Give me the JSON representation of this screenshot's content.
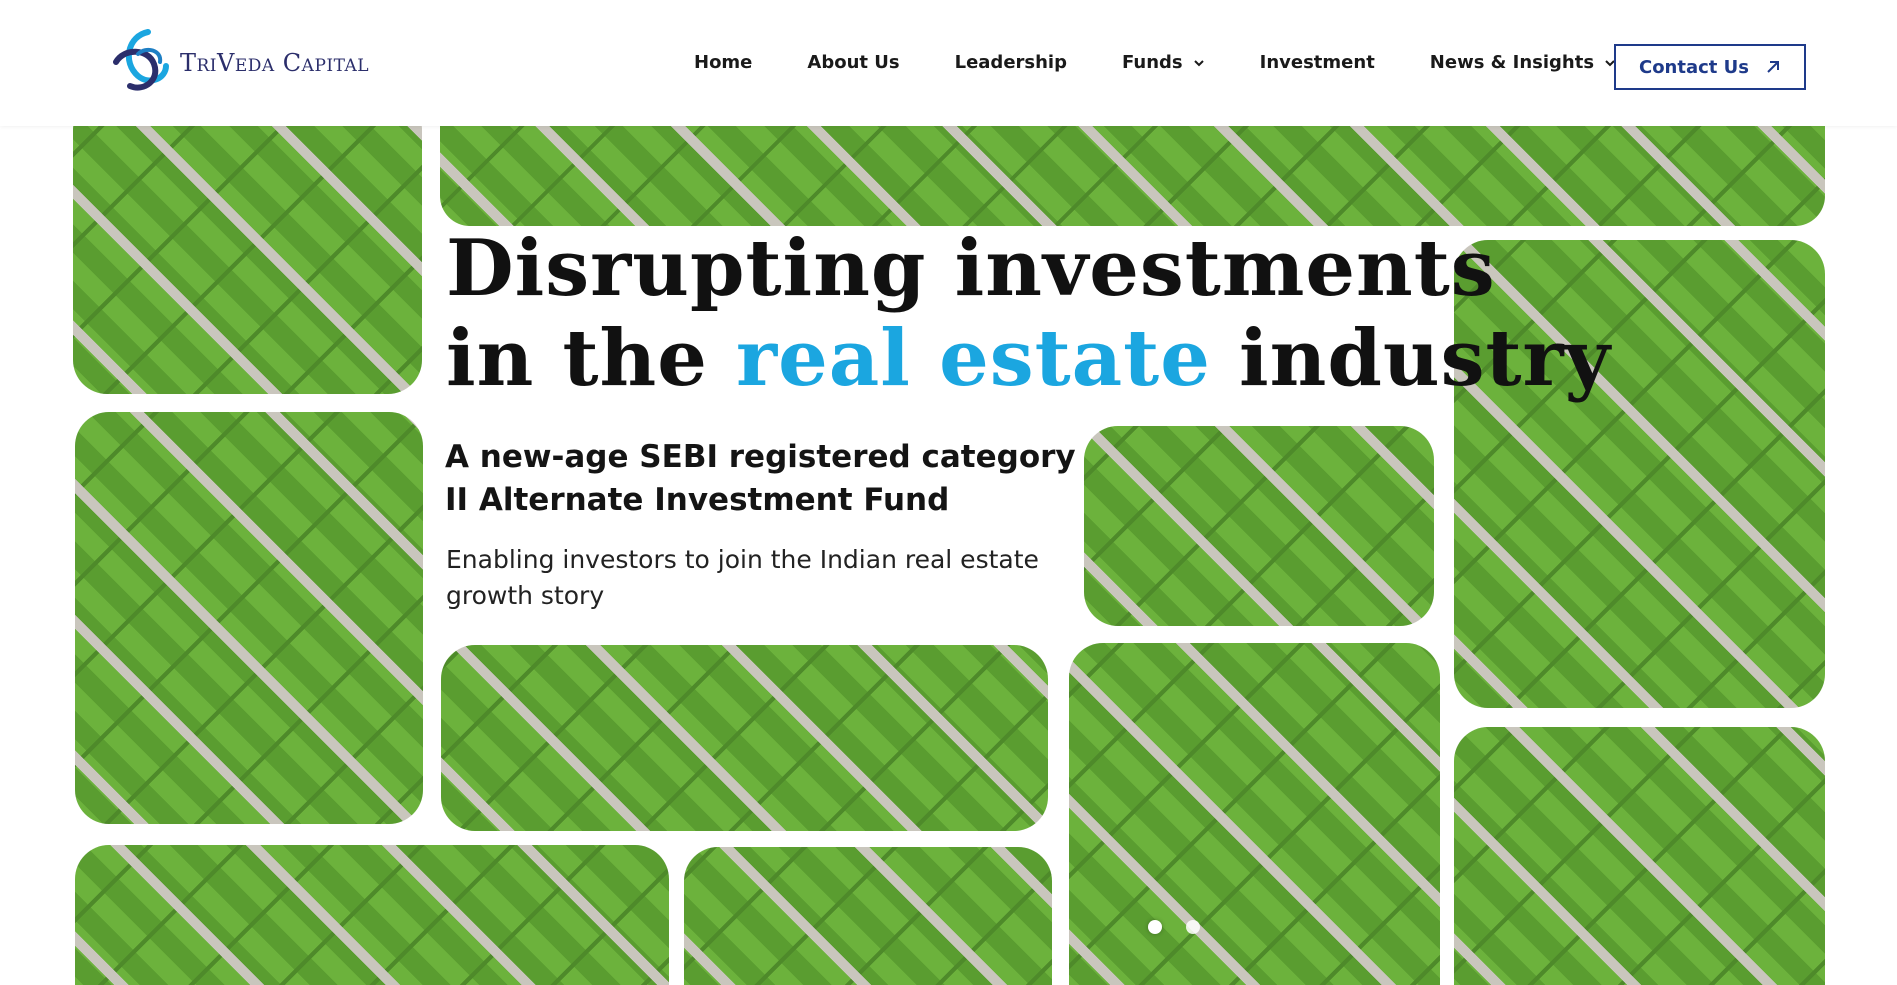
{
  "brand": {
    "logo_text": "TriVeda Capital",
    "logo_icon": "triveda-swirl-logo",
    "colors": {
      "primary": "#1e3a8a",
      "accent": "#1ba6e0",
      "logo_dark": "#2b2e6b"
    }
  },
  "nav": {
    "items": [
      {
        "label": "Home",
        "has_dropdown": false
      },
      {
        "label": "About Us",
        "has_dropdown": false
      },
      {
        "label": "Leadership",
        "has_dropdown": false
      },
      {
        "label": "Funds",
        "has_dropdown": true
      },
      {
        "label": "Investment",
        "has_dropdown": false
      },
      {
        "label": "News & Insights",
        "has_dropdown": true
      }
    ],
    "cta_label": "Contact Us",
    "cta_icon": "arrow-up-right-icon"
  },
  "hero": {
    "headline_line1": "Disrupting investments",
    "headline_line2_pre": "in the ",
    "headline_line2_accent": "real estate",
    "headline_line2_post": " industry",
    "subheading": "A new-age SEBI registered category II Alternate Investment Fund",
    "description": "Enabling investors to join the Indian real estate growth story",
    "slider_dots": 2,
    "active_dot": 0
  }
}
